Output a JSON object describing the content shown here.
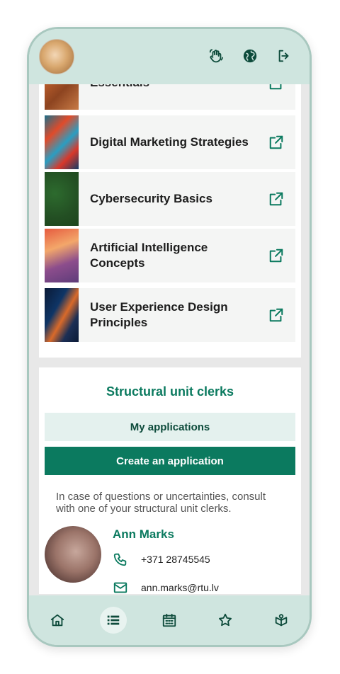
{
  "colors": {
    "accent": "#0b7a5f",
    "topbar_bg": "#cfe5df",
    "button_light_bg": "#e4f1ee"
  },
  "header": {
    "avatar": "cat-avatar",
    "icons": [
      "hand-wave-icon",
      "globe-icon",
      "logout-icon"
    ]
  },
  "courses": [
    {
      "title": "Essentials",
      "thumb": "t1"
    },
    {
      "title": "Digital Marketing Strategies",
      "thumb": "t2"
    },
    {
      "title": "Cybersecurity Basics",
      "thumb": "t3"
    },
    {
      "title": "Artificial Intelligence Concepts",
      "thumb": "t4"
    },
    {
      "title": "User Experience Design Principles",
      "thumb": "t5"
    }
  ],
  "clerks_section": {
    "title": "Structural unit clerks",
    "my_applications_label": "My applications",
    "create_application_label": "Create an application",
    "hint": "In case of questions or uncertainties, consult with one of your structural unit clerks.",
    "clerk": {
      "name": "Ann Marks",
      "phone": "+371 28745545",
      "email": "ann.marks@rtu.lv"
    }
  },
  "bottom_nav": {
    "items": [
      "home",
      "list",
      "calendar",
      "favorites",
      "map"
    ],
    "active": "list"
  }
}
